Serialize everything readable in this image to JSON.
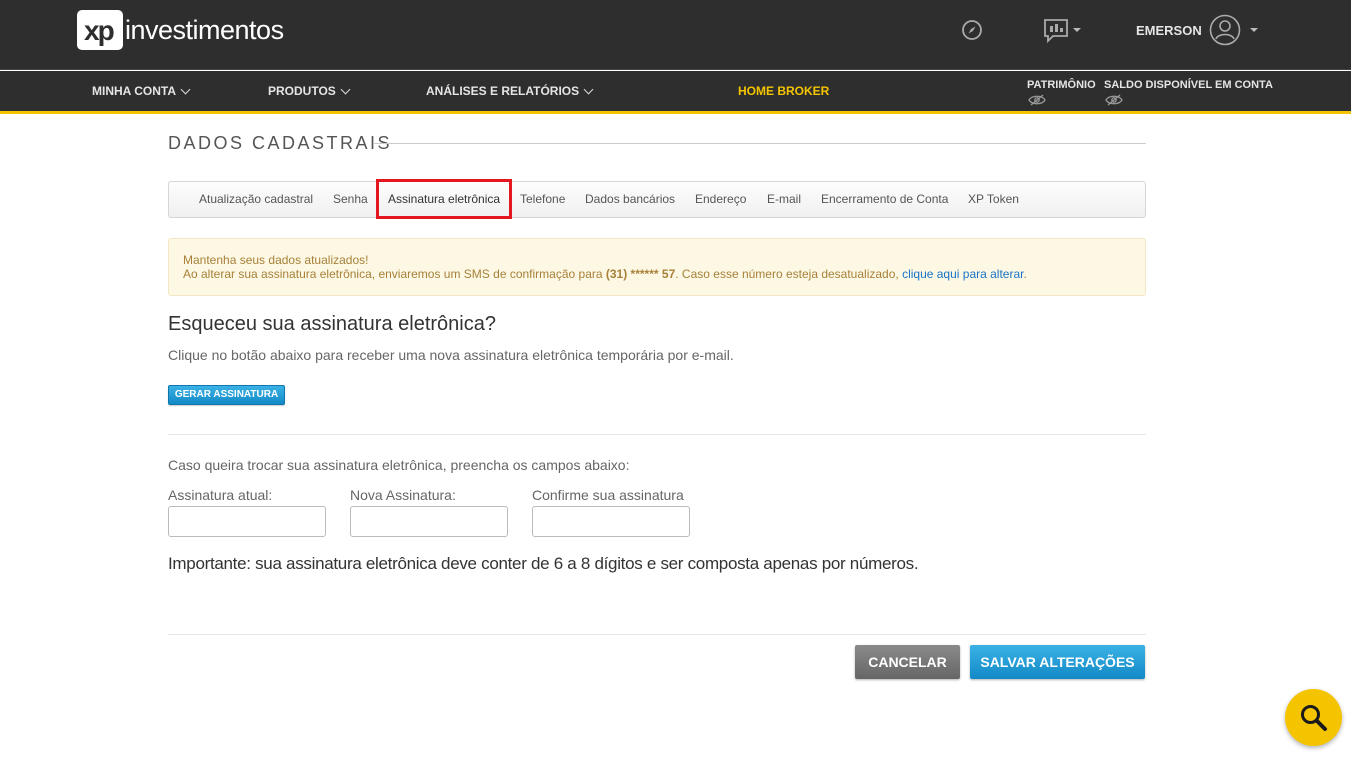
{
  "header": {
    "logo_box_text": "xp",
    "logo_text": "investimentos",
    "user_name": "EMERSON",
    "icons": [
      "compass-icon",
      "chat-chart-icon",
      "user-avatar-icon"
    ]
  },
  "nav": {
    "items": [
      {
        "label": "MINHA CONTA"
      },
      {
        "label": "PRODUTOS"
      },
      {
        "label": "ANÁLISES E RELATÓRIOS"
      }
    ],
    "home_broker": "HOME BROKER",
    "patrimonio": "PATRIMÔNIO",
    "saldo": "SALDO DISPONÍVEL EM CONTA",
    "accent_color": "#f5c400"
  },
  "page": {
    "title": "DADOS CADASTRAIS"
  },
  "tabs": [
    {
      "label": "Atualização cadastral"
    },
    {
      "label": "Senha"
    },
    {
      "label": "Assinatura eletrônica",
      "active": true
    },
    {
      "label": "Telefone"
    },
    {
      "label": "Dados bancários"
    },
    {
      "label": "Endereço"
    },
    {
      "label": "E-mail"
    },
    {
      "label": "Encerramento de Conta"
    },
    {
      "label": "XP Token"
    }
  ],
  "alert": {
    "line1": "Mantenha seus dados atualizados!",
    "line2_prefix": "Ao alterar sua assinatura eletrônica, enviaremos um SMS de confirmação para ",
    "phone": "(31)  ******  57",
    "line2_mid": ". Caso esse número esteja desatualizado, ",
    "link": "clique aqui para alterar",
    "line2_suffix": "."
  },
  "forgot": {
    "heading": "Esqueceu sua assinatura eletrônica?",
    "description": "Clique no botão abaixo para receber uma nova assinatura eletrônica temporária por e-mail.",
    "button": "GERAR ASSINATURA"
  },
  "change": {
    "instruction": "Caso queira trocar sua assinatura eletrônica, preencha os campos abaixo:",
    "fields": [
      {
        "label": "Assinatura atual:",
        "value": ""
      },
      {
        "label": "Nova Assinatura:",
        "value": ""
      },
      {
        "label": "Confirme sua assinatura",
        "value": ""
      }
    ],
    "important": "Importante: sua assinatura eletrônica deve conter de 6 a 8 dígitos e ser composta apenas por números."
  },
  "actions": {
    "cancel": "CANCELAR",
    "save": "SALVAR ALTERAÇÕES"
  },
  "fab": {
    "icon": "search-icon"
  }
}
